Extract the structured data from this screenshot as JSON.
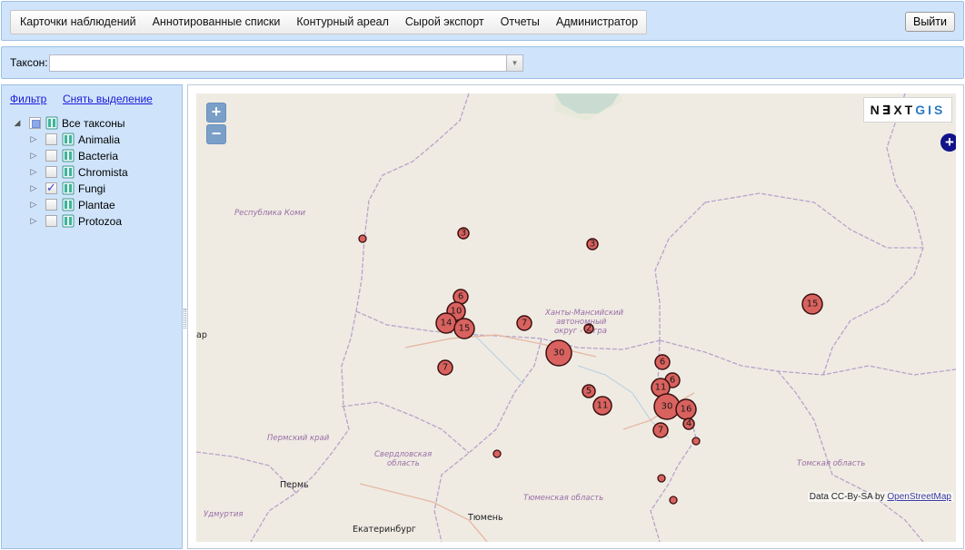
{
  "nav": {
    "menu": [
      "Карточки наблюдений",
      "Аннотированные списки",
      "Контурный ареал",
      "Сырой экспорт",
      "Отчеты",
      "Администратор"
    ],
    "logout": "Выйти"
  },
  "taxon_filter": {
    "label": "Таксон:",
    "value": ""
  },
  "sidebar": {
    "filter_link": "Фильтр",
    "clear_link": "Снять выделение",
    "tree": {
      "root": {
        "label": "Все таксоны",
        "state": "partial"
      },
      "children": [
        {
          "label": "Animalia",
          "checked": false
        },
        {
          "label": "Bacteria",
          "checked": false
        },
        {
          "label": "Chromista",
          "checked": false
        },
        {
          "label": "Fungi",
          "checked": true
        },
        {
          "label": "Plantae",
          "checked": false
        },
        {
          "label": "Protozoa",
          "checked": false
        }
      ]
    }
  },
  "map": {
    "zoom_in": "+",
    "zoom_out": "−",
    "logo": {
      "main": "NEXT",
      "accent": "GIS",
      "display": "N∃XT"
    },
    "layer_switcher": "+",
    "attribution_text": "Data CC-By-SA by ",
    "attribution_link": "OpenStreetMap",
    "region_labels": [
      "Республика Коми",
      "Ханты-Мансийский",
      "автономный",
      "округ - Югра",
      "Пермский край",
      "Свердловская",
      "область",
      "Тюменская область",
      "Томская область",
      "Удмуртия"
    ],
    "city_labels": [
      "Пермь",
      "Екатеринбург",
      "Тюмень",
      "ар"
    ],
    "cluster_counts": [
      3,
      3,
      6,
      10,
      14,
      15,
      7,
      30,
      7,
      15,
      6,
      6,
      11,
      5,
      11,
      30,
      16,
      4,
      7,
      2
    ],
    "colors": {
      "cluster_fill": "#d9625f",
      "cluster_stroke": "#3a1010",
      "panel_bg": "#cfe4fb"
    }
  }
}
